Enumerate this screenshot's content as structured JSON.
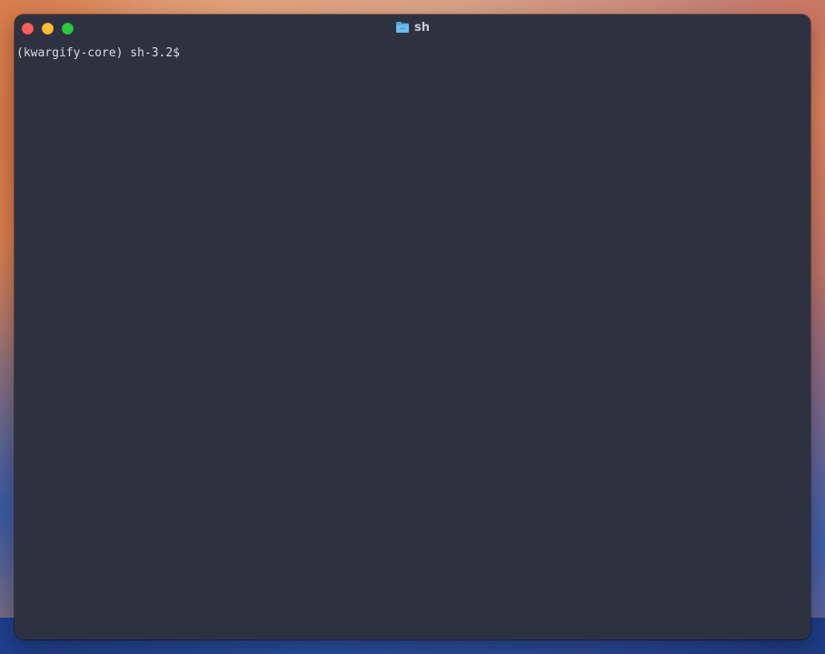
{
  "window": {
    "title": "sh",
    "title_icon": "folder-icon",
    "controls": [
      "close",
      "minimize",
      "zoom"
    ]
  },
  "terminal": {
    "prompt": "(kwargify-core) sh-3.2$"
  },
  "colors": {
    "window_bg": "#2e3240",
    "text": "#d8dbe3",
    "close": "#fe5f57",
    "minimize": "#febc2e",
    "zoom": "#28c840",
    "folder": "#4fa9e6"
  }
}
